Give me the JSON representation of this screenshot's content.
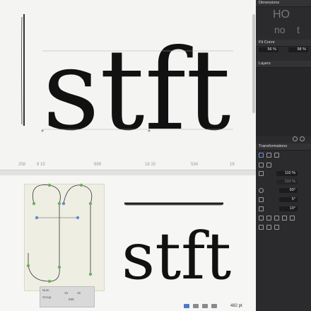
{
  "canvas": {
    "upper_word": "stft",
    "lower_word": "stft",
    "metrics": [
      "258",
      "8 15",
      "699",
      "18 15",
      "534",
      "16"
    ]
  },
  "panel": {
    "dimensions": {
      "title": "Dimensions",
      "preview": [
        "HO",
        "no",
        "t"
      ]
    },
    "fit_curve": {
      "title": "Fit Curve",
      "min": "56 %",
      "max": "98 %"
    },
    "layers": {
      "title": "Layers"
    },
    "transformations": {
      "title": "Transformations",
      "scale": "110 %",
      "scale2": "110 %",
      "rotate": "90°",
      "slant1": "5°",
      "slant2": "10°"
    }
  },
  "inspector": {
    "label_a": "Num",
    "label_b": "Group",
    "left": "15",
    "right": "15",
    "value": "699"
  },
  "bottom": {
    "zoom": "482 pt"
  },
  "colors": {
    "accent": "#4c79c9",
    "panel": "#2b2b2d"
  }
}
